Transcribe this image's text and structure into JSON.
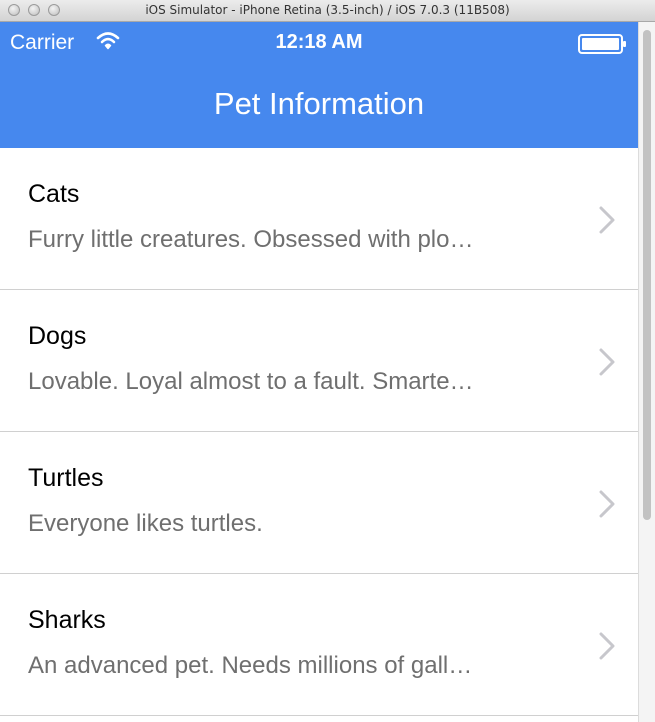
{
  "window": {
    "title": "iOS Simulator - iPhone Retina (3.5-inch) / iOS 7.0.3 (11B508)"
  },
  "status": {
    "carrier": "Carrier",
    "time": "12:18 AM"
  },
  "nav": {
    "title": "Pet Information"
  },
  "pets": [
    {
      "title": "Cats",
      "subtitle": "Furry little creatures. Obsessed with plo…"
    },
    {
      "title": "Dogs",
      "subtitle": "Lovable. Loyal almost to a fault. Smarte…"
    },
    {
      "title": "Turtles",
      "subtitle": "Everyone likes turtles."
    },
    {
      "title": "Sharks",
      "subtitle": "An advanced pet. Needs millions of gall…"
    }
  ],
  "colors": {
    "navbar": "#4688ee",
    "subtitle": "#6f6f6f",
    "chevron": "#c7c7cc"
  },
  "icons": [
    "wifi-icon",
    "battery-icon",
    "chevron-right-icon"
  ]
}
